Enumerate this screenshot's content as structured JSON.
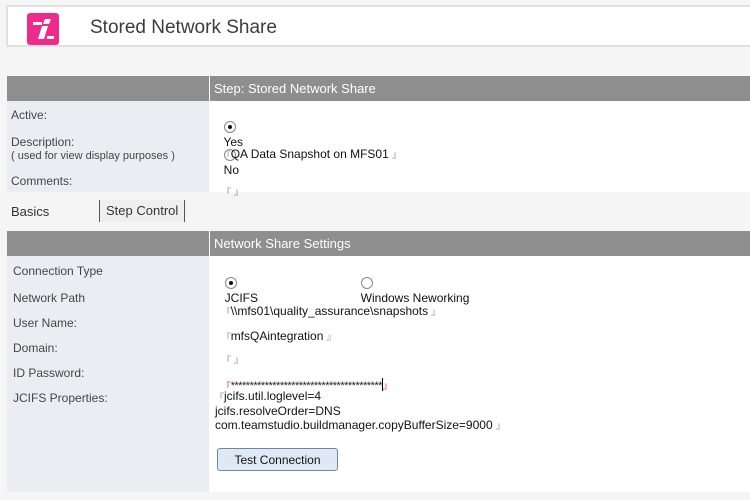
{
  "header": {
    "title": "Stored Network Share",
    "logo_icon": "app-logo-icon",
    "brand_color": "#ee2a8b"
  },
  "step_section": {
    "heading": "Step:  Stored Network Share",
    "active": {
      "label": "Active:",
      "options": [
        "Yes",
        "No"
      ],
      "selected": "Yes"
    },
    "description": {
      "label": "Description:",
      "sublabel": "( used for view display purposes )",
      "value": "QA Data Snapshot on MFS01"
    },
    "comments": {
      "label": "Comments:",
      "value": ""
    }
  },
  "tabs": [
    {
      "label": "Basics",
      "active": true
    },
    {
      "label": "Step Control",
      "active": false
    }
  ],
  "settings_section": {
    "heading": "Network Share Settings",
    "connection_type": {
      "label": "Connection Type",
      "options": [
        "JCIFS",
        "Windows Neworking"
      ],
      "selected": "JCIFS"
    },
    "network_path": {
      "label": "Network Path",
      "value": "\\\\mfs01\\quality_assurance\\snapshots"
    },
    "user_name": {
      "label": "User Name:",
      "value": "mfsQAintegration"
    },
    "domain": {
      "label": "Domain:",
      "value": ""
    },
    "id_password": {
      "label": "ID Password:",
      "value": "****************************************"
    },
    "jcifs_properties": {
      "label": "JCIFS Properties:",
      "lines": [
        "jcifs.util.loglevel=4",
        "jcifs.resolveOrder=DNS",
        "com.teamstudio.buildmanager.copyBufferSize=9000"
      ]
    },
    "test_button": "Test Connection"
  },
  "field_marks": {
    "open": "『",
    "close": "』"
  }
}
